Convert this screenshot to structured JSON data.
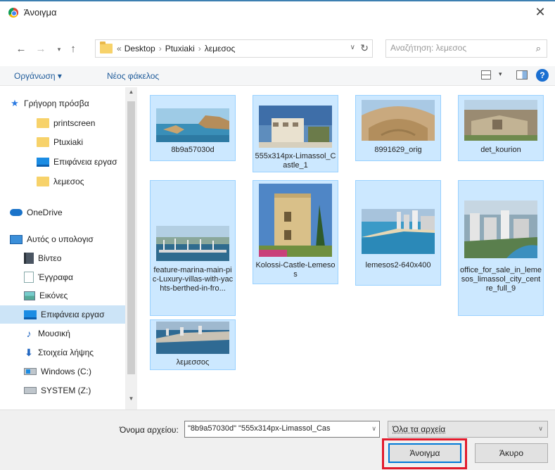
{
  "window": {
    "title": "Άνοιγμα",
    "close_glyph": "✕"
  },
  "address": {
    "back_glyph": "←",
    "forward_glyph": "→",
    "recent_glyph": "▾",
    "up_glyph": "↑",
    "prefix": "«",
    "crumbs": [
      "Desktop",
      "Ptuxiaki",
      "λεμεσος"
    ],
    "separator": "›",
    "dropdown_glyph": "∨",
    "refresh_glyph": "↻",
    "search_placeholder": "Αναζήτηση: λεμεσος",
    "search_glyph": "⌕"
  },
  "toolbar": {
    "organize": "Οργάνωση ▾",
    "new_folder": "Νέος φάκελος",
    "view_drop": "▾",
    "help": "?"
  },
  "nav": {
    "items": [
      {
        "label": "Γρήγορη πρόσβα",
        "icon": "quick-access-star-icon",
        "glyph": "★"
      },
      {
        "label": "printscreen",
        "icon": "folder-icon"
      },
      {
        "label": "Ptuxiaki",
        "icon": "folder-icon"
      },
      {
        "label": "Επιφάνεια εργασ",
        "icon": "desktop-folder-icon"
      },
      {
        "label": "λεμεσος",
        "icon": "folder-icon"
      },
      {
        "label": "OneDrive",
        "icon": "onedrive-cloud-icon"
      },
      {
        "label": "Αυτός ο υπολογισ",
        "icon": "this-pc-icon"
      },
      {
        "label": "Βίντεο",
        "icon": "videos-icon"
      },
      {
        "label": "Έγγραφα",
        "icon": "documents-icon"
      },
      {
        "label": "Εικόνες",
        "icon": "pictures-icon"
      },
      {
        "label": "Επιφάνεια εργασ",
        "icon": "desktop-folder-icon",
        "selected": true
      },
      {
        "label": "Μουσική",
        "icon": "music-icon",
        "glyph": "♪"
      },
      {
        "label": "Στοιχεία λήψης",
        "icon": "downloads-icon",
        "glyph": "⬇"
      },
      {
        "label": "Windows (C:)",
        "icon": "windows-drive-icon"
      },
      {
        "label": "SYSTEM (Z:)",
        "icon": "drive-icon"
      }
    ],
    "scroll_up": "▲",
    "scroll_down": "▼"
  },
  "files": [
    {
      "name": "8b9a57030d"
    },
    {
      "name": "555x314px-Limassol_Castle_1"
    },
    {
      "name": "8991629_orig"
    },
    {
      "name": "det_kourion"
    },
    {
      "name": "feature-marina-main-pic-Luxury-villas-with-yachts-berthed-in-fro..."
    },
    {
      "name": "Kolossi-Castle-Lemesos"
    },
    {
      "name": "lemesos2-640x400"
    },
    {
      "name": "office_for_sale_in_lemesos_limassol_city_centre_full_9"
    },
    {
      "name": "λεμεσσος"
    }
  ],
  "bottom": {
    "filename_label": "Όνομα αρχείου:",
    "filename_value": "\"8b9a57030d\" \"555x314px-Limassol_Cas",
    "dropdown_glyph": "∨",
    "filetype_value": "Όλα τα αρχεία",
    "open_label": "Άνοιγμα",
    "cancel_label": "Άκυρο"
  },
  "colors": {
    "selection": "#cce8ff",
    "highlight_box": "#e21b2d",
    "accent": "#0078d7"
  }
}
